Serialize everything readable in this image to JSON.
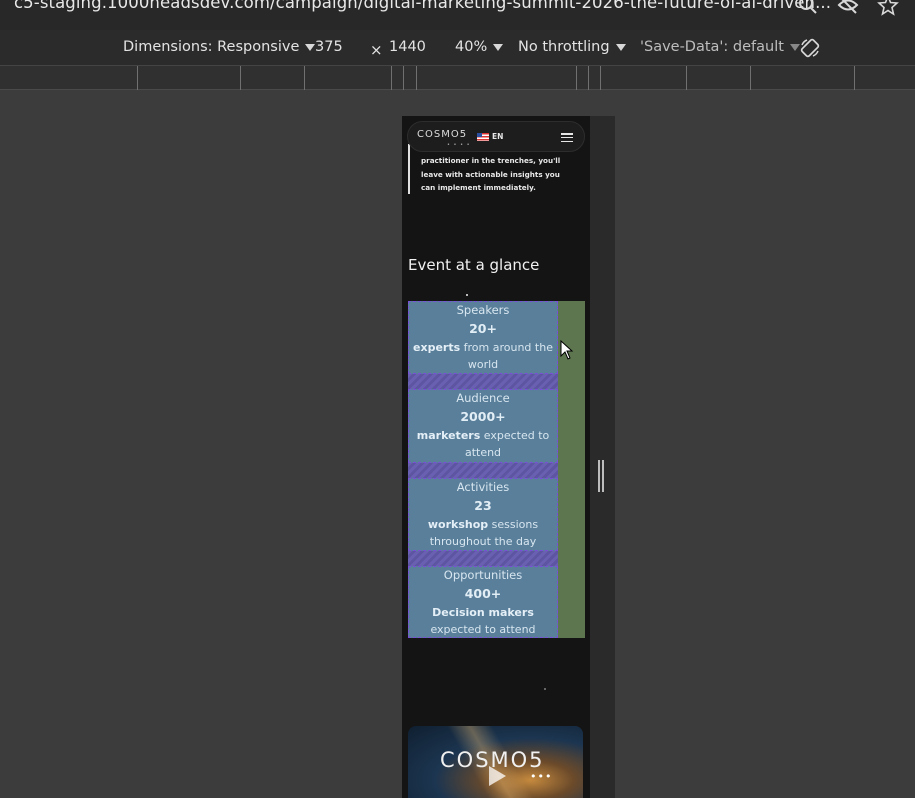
{
  "browser": {
    "url": "c5-staging.1000headsdev.com/campaign/digital-marketing-summit-2026-the-future-of-ai-driven..."
  },
  "device_toolbar": {
    "dimensions_label": "Dimensions: Responsive",
    "width": "375",
    "times": "×",
    "height": "1440",
    "zoom": "40%",
    "throttling": "No throttling",
    "save_data": "'Save-Data': default"
  },
  "site": {
    "logo": "COSMO5",
    "logo_sub": "• • • •",
    "lang": "EN",
    "intro": "practitioner in the trenches, you'll leave with actionable insights you can implement immediately.",
    "section_heading": "Event at a glance",
    "stats": [
      {
        "label": "Speakers",
        "value": "20+",
        "desc_bold": "experts",
        "desc_rest": " from around the world"
      },
      {
        "label": "Audience",
        "value": "2000+",
        "desc_bold": "marketers",
        "desc_rest": " expected to attend"
      },
      {
        "label": "Activities",
        "value": "23",
        "desc_bold": "workshop",
        "desc_rest": " sessions throughout the day"
      },
      {
        "label": "Opportunities",
        "value": "400+",
        "desc_bold": "Decision makers",
        "desc_rest": " expected to attend"
      }
    ],
    "video_logo": "COSMO5",
    "video_more": "•••"
  }
}
